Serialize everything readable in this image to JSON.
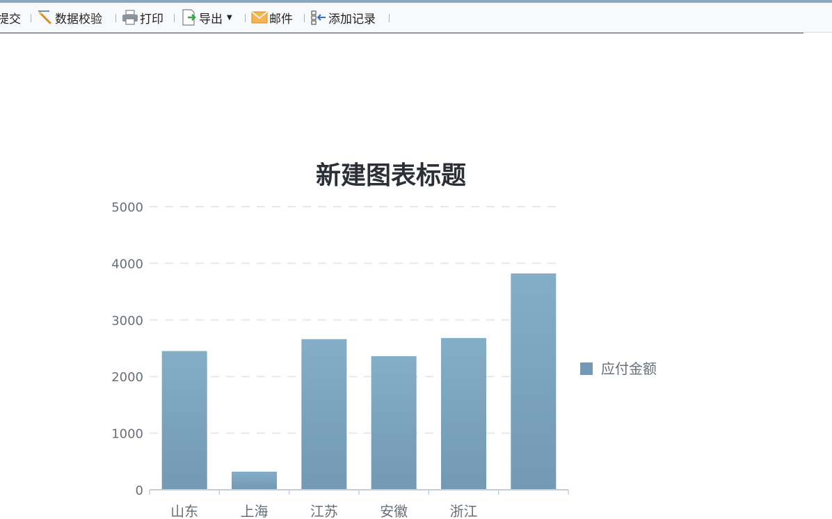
{
  "toolbar": {
    "submit_label": "提交",
    "validate_label": "数据校验",
    "print_label": "打印",
    "export_label": "导出",
    "email_label": "邮件",
    "add_record_label": "添加记录"
  },
  "colors": {
    "bar_top": "#84adc8",
    "bar_bottom": "#7399b4",
    "title": "#2b2f36",
    "axis_text": "#666f78",
    "grid": "#e6e9ec"
  },
  "chart_data": {
    "type": "bar",
    "title": "新建图表标题",
    "categories": [
      "山东",
      "上海",
      "江苏",
      "安徽",
      "浙江",
      ""
    ],
    "series": [
      {
        "name": "应付金额",
        "values": [
          2450,
          320,
          2660,
          2360,
          2680,
          3820
        ]
      }
    ],
    "ylim": [
      0,
      5000
    ],
    "yticks": [
      "0",
      "1000",
      "2000",
      "3000",
      "4000",
      "5000"
    ],
    "grid": true,
    "legend_position": "right"
  }
}
